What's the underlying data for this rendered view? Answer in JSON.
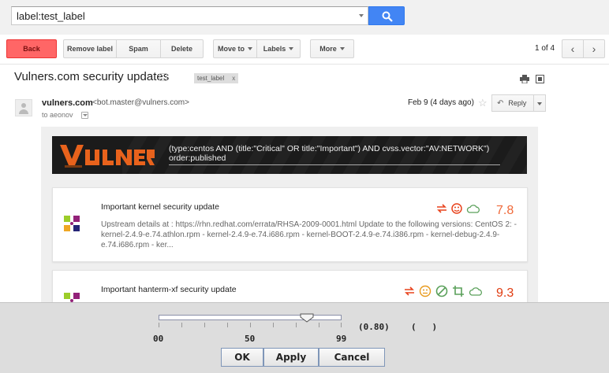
{
  "search": {
    "value": "label:test_label"
  },
  "toolbar": {
    "back": "Back",
    "remove_label": "Remove label",
    "spam": "Spam",
    "delete": "Delete",
    "move_to": "Move to",
    "labels": "Labels",
    "more": "More",
    "pager": "1 of 4",
    "prev": "‹",
    "next": "›"
  },
  "thread": {
    "subject": "Vulners.com security updates",
    "label_chip": "test_label",
    "label_chip_remove": "x"
  },
  "message": {
    "sender_name": "vulners.com",
    "sender_email": "<bot.master@vulners.com>",
    "to_line": "to aeonov",
    "date": "Feb 9 (4 days ago)",
    "reply": "Reply"
  },
  "banner": {
    "query": "(type:centos AND (title:\"Critical\" OR title:\"Important\") AND cvss.vector:\"AV:NETWORK\") order:published"
  },
  "cards": [
    {
      "title": "Important kernel security update",
      "description": "Upstream details at : https://rhn.redhat.com/errata/RHSA-2009-0001.html Update to the following versions: CentOS 2: - kernel-2.4.9-e.74.athlon.rpm - kernel-2.4.9-e.74.i686.rpm - kernel-BOOT-2.4.9-e.74.i386.rpm - kernel-debug-2.4.9-e.74.i686.rpm - ker...",
      "score": "7.8",
      "score_color": "#f06a3a"
    },
    {
      "title": "Important hanterm-xf security update",
      "score": "9.3",
      "score_color": "#e03b10"
    }
  ],
  "dialog": {
    "tick_min": "00",
    "tick_mid": "50",
    "tick_max": "99",
    "value_display": "(0.80)",
    "extra_display": "(   )",
    "slider_value": 0.8,
    "ok": "OK",
    "apply": "Apply",
    "cancel": "Cancel"
  },
  "colors": {
    "back_button": "#ff6666",
    "search_button": "#4285f4",
    "accent_orange": "#f06a3a",
    "icon_green": "#5aa05a"
  }
}
